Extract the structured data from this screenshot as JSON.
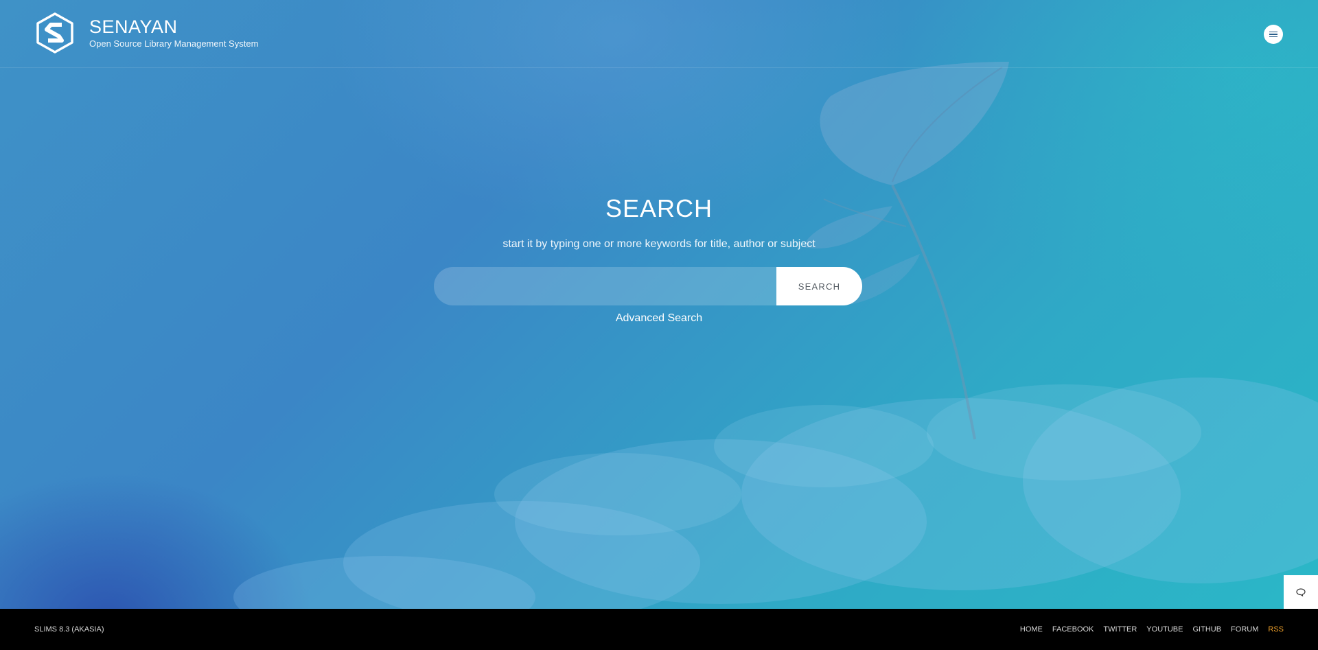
{
  "header": {
    "brand_title": "SENAYAN",
    "brand_subtitle": "Open Source Library Management System",
    "logo_icon": "hexagon-s-logo-icon",
    "menu_icon": "hamburger-menu-icon"
  },
  "search": {
    "title": "SEARCH",
    "hint": "start it by typing one or more keywords for title, author or subject",
    "input_value": "",
    "input_placeholder": "",
    "button_label": "SEARCH",
    "advanced_label": "Advanced Search"
  },
  "chat": {
    "icon": "chat-bubble-icon"
  },
  "footer": {
    "version": "SLIMS 8.3 (AKASIA)",
    "links": [
      "HOME",
      "FACEBOOK",
      "TWITTER",
      "YOUTUBE",
      "GITHUB",
      "FORUM",
      "RSS"
    ]
  },
  "colors": {
    "footer_bg": "#000000",
    "rss_accent": "#f0a12a",
    "bg_blue": "#3b86c6",
    "bg_teal": "#2ab8c7"
  }
}
